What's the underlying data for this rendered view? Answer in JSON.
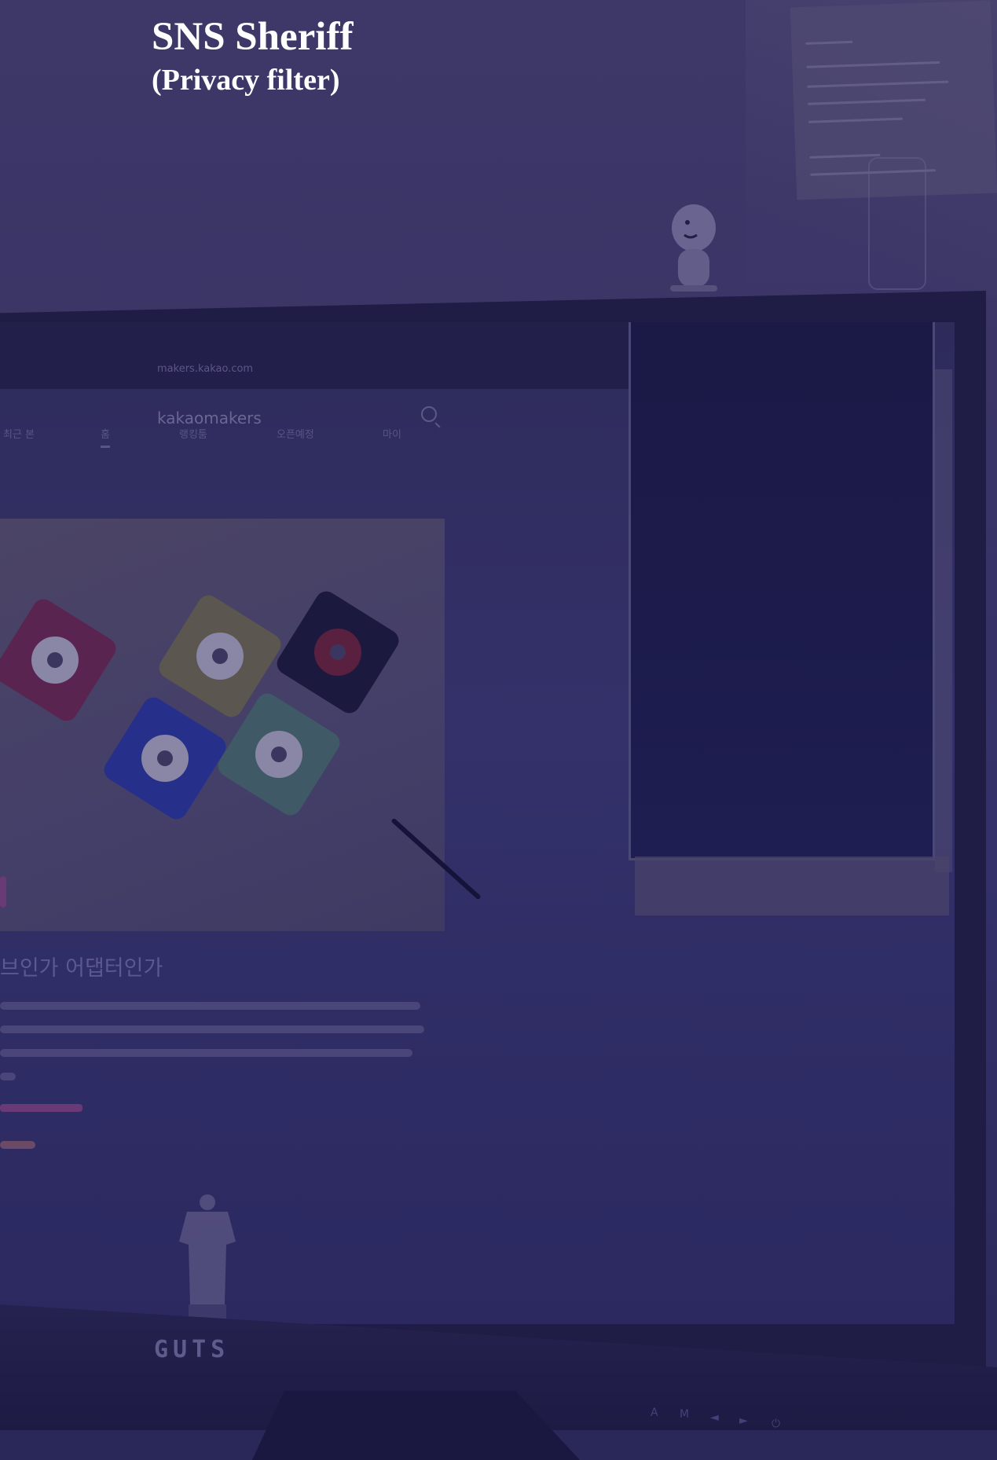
{
  "caption": {
    "title": "SNS Sheriff",
    "subtitle": "(Privacy filter)"
  },
  "browser": {
    "url": "makers.kakao.com",
    "site_logo": "kakaomakers",
    "tabs": [
      "최근 본",
      "홈",
      "랭킹툼",
      "오픈예정",
      "마이"
    ],
    "headline": "브인가 어댑터인가"
  },
  "monitor": {
    "brand": "GUTS",
    "controls": [
      "A",
      "M",
      "◄",
      "►",
      "⏻"
    ]
  },
  "colors": {
    "overlay": "#2d2a5c",
    "title_text": "#ffffff"
  }
}
